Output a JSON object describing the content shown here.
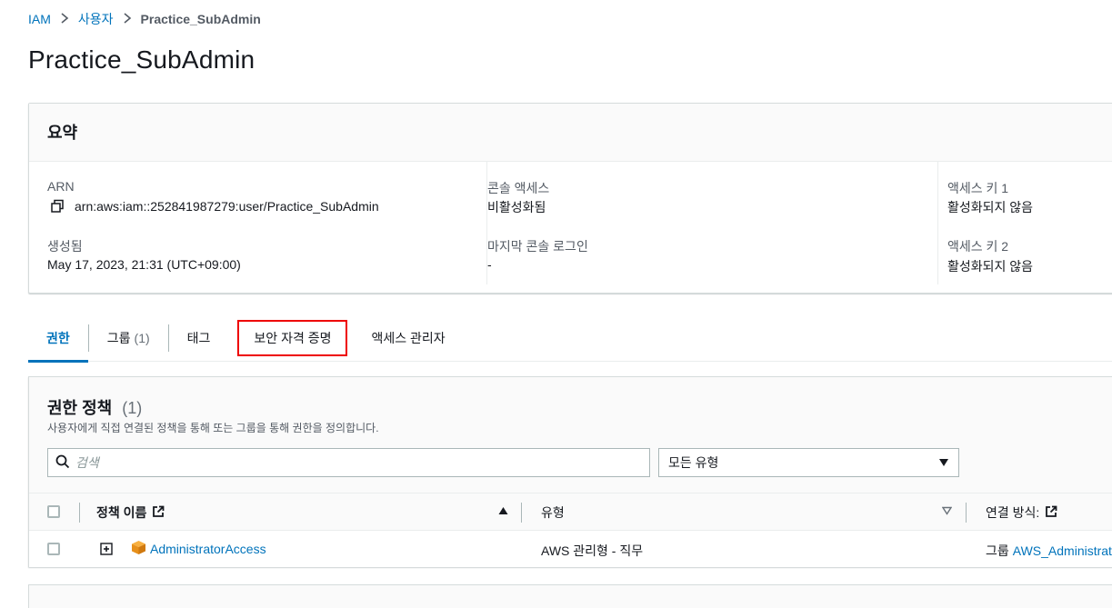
{
  "breadcrumb": {
    "root": "IAM",
    "users": "사용자",
    "current": "Practice_SubAdmin"
  },
  "page_title": "Practice_SubAdmin",
  "summary": {
    "title": "요약",
    "arn_label": "ARN",
    "arn_value": "arn:aws:iam::252841987279:user/Practice_SubAdmin",
    "created_label": "생성됨",
    "created_value": "May 17, 2023, 21:31 (UTC+09:00)",
    "console_access_label": "콘솔 액세스",
    "console_access_value": "비활성화됨",
    "last_console_login_label": "마지막 콘솔 로그인",
    "last_console_login_value": "-",
    "access_key1_label": "액세스 키 1",
    "access_key1_value": "활성화되지 않음",
    "access_key2_label": "액세스 키 2",
    "access_key2_value": "활성화되지 않음"
  },
  "tabs": [
    {
      "label": "권한",
      "count": "",
      "active": true
    },
    {
      "label": "그룹",
      "count": "(1)"
    },
    {
      "label": "태그",
      "count": ""
    },
    {
      "label": "보안 자격 증명",
      "count": "",
      "highlighted": true
    },
    {
      "label": "액세스 관리자",
      "count": ""
    }
  ],
  "permissions": {
    "title": "권한 정책",
    "count": "(1)",
    "description": "사용자에게 직접 연결된 정책을 통해 또는 그룹을 통해 권한을 정의합니다.",
    "search_placeholder": "검색",
    "filter_selected": "모든 유형",
    "columns": {
      "policy_name": "정책 이름",
      "type": "유형",
      "attached_via": "연결 방식:"
    },
    "rows": [
      {
        "policy_name": "AdministratorAccess",
        "type": "AWS 관리형 - 직무",
        "attached_via_prefix": "그룹",
        "attached_via_link": "AWS_Administrat"
      }
    ]
  },
  "colors": {
    "link": "#0073bb",
    "highlight": "#e00000",
    "header_bg": "#fafafa",
    "border": "#d5dbdb"
  }
}
